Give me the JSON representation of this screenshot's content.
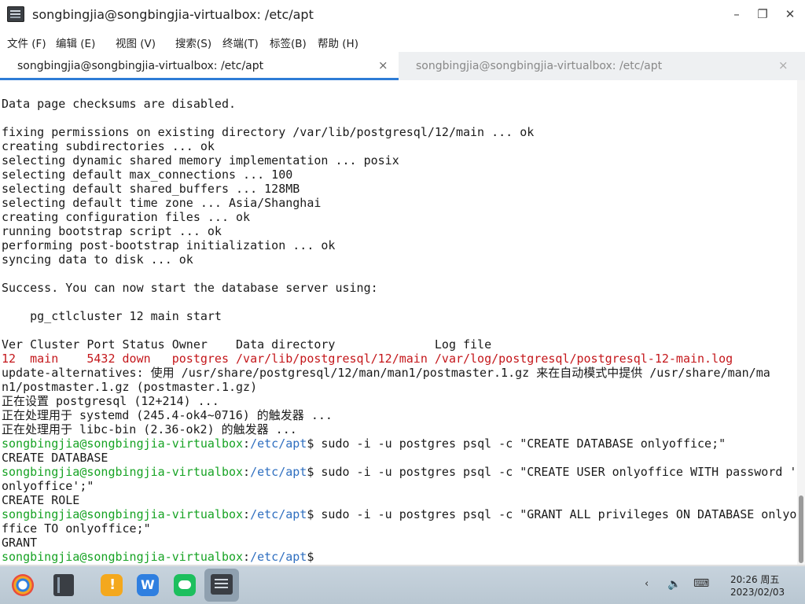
{
  "window": {
    "title": "songbingjia@songbingjia-virtualbox: /etc/apt",
    "minimize_icon": "minimize-icon",
    "maximize_icon": "restore-icon",
    "close_icon": "close-icon",
    "minimize_glyph": "–",
    "maximize_glyph": "❐",
    "close_glyph": "✕"
  },
  "menu": [
    {
      "label": "文件 (F)"
    },
    {
      "label": "编辑 (E)"
    },
    {
      "label": "视图 (V)"
    },
    {
      "label": "搜索(S)"
    },
    {
      "label": "终端(T)"
    },
    {
      "label": "标签(B)"
    },
    {
      "label": "帮助 (H)"
    }
  ],
  "tabs": [
    {
      "label": "songbingjia@songbingjia-virtualbox: /etc/apt",
      "active": true,
      "close": "×"
    },
    {
      "label": "songbingjia@songbingjia-virtualbox: /etc/apt",
      "active": false,
      "close": "×"
    }
  ],
  "terminal": {
    "lines": [
      [
        {
          "t": "Data page checksums are disabled."
        }
      ],
      [
        {
          "t": ""
        }
      ],
      [
        {
          "t": "fixing permissions on existing directory /var/lib/postgresql/12/main ... ok"
        }
      ],
      [
        {
          "t": "creating subdirectories ... ok"
        }
      ],
      [
        {
          "t": "selecting dynamic shared memory implementation ... posix"
        }
      ],
      [
        {
          "t": "selecting default max_connections ... 100"
        }
      ],
      [
        {
          "t": "selecting default shared_buffers ... 128MB"
        }
      ],
      [
        {
          "t": "selecting default time zone ... Asia/Shanghai"
        }
      ],
      [
        {
          "t": "creating configuration files ... ok"
        }
      ],
      [
        {
          "t": "running bootstrap script ... ok"
        }
      ],
      [
        {
          "t": "performing post-bootstrap initialization ... ok"
        }
      ],
      [
        {
          "t": "syncing data to disk ... ok"
        }
      ],
      [
        {
          "t": ""
        }
      ],
      [
        {
          "t": "Success. You can now start the database server using:"
        }
      ],
      [
        {
          "t": ""
        }
      ],
      [
        {
          "t": "    pg_ctlcluster 12 main start"
        }
      ],
      [
        {
          "t": ""
        }
      ],
      [
        {
          "t": "Ver Cluster Port Status Owner    Data directory              Log file"
        }
      ],
      [
        {
          "t": "12  main    5432 down   postgres /var/lib/postgresql/12/main /var/log/postgresql/postgresql-12-main.log",
          "c": "red"
        }
      ],
      [
        {
          "t": "update-alternatives: 使用 /usr/share/postgresql/12/man/man1/postmaster.1.gz 来在自动模式中提供 /usr/share/man/ma"
        }
      ],
      [
        {
          "t": "n1/postmaster.1.gz (postmaster.1.gz)"
        }
      ],
      [
        {
          "t": "正在设置 postgresql (12+214) ..."
        }
      ],
      [
        {
          "t": "正在处理用于 systemd (245.4-ok4~0716) 的触发器 ..."
        }
      ],
      [
        {
          "t": "正在处理用于 libc-bin (2.36-ok2) 的触发器 ..."
        }
      ],
      [
        {
          "t": "songbingjia@songbingjia-virtualbox",
          "c": "user"
        },
        {
          "t": ":"
        },
        {
          "t": "/etc/apt",
          "c": "path"
        },
        {
          "t": "$ sudo -i -u postgres psql -c \"CREATE DATABASE onlyoffice;\""
        }
      ],
      [
        {
          "t": "CREATE DATABASE"
        }
      ],
      [
        {
          "t": "songbingjia@songbingjia-virtualbox",
          "c": "user"
        },
        {
          "t": ":"
        },
        {
          "t": "/etc/apt",
          "c": "path"
        },
        {
          "t": "$ sudo -i -u postgres psql -c \"CREATE USER onlyoffice WITH password '"
        }
      ],
      [
        {
          "t": "onlyoffice';\""
        }
      ],
      [
        {
          "t": "CREATE ROLE"
        }
      ],
      [
        {
          "t": "songbingjia@songbingjia-virtualbox",
          "c": "user"
        },
        {
          "t": ":"
        },
        {
          "t": "/etc/apt",
          "c": "path"
        },
        {
          "t": "$ sudo -i -u postgres psql -c \"GRANT ALL privileges ON DATABASE onlyo"
        }
      ],
      [
        {
          "t": "ffice TO onlyoffice;\""
        }
      ],
      [
        {
          "t": "GRANT"
        }
      ],
      [
        {
          "t": "songbingjia@songbingjia-virtualbox",
          "c": "user"
        },
        {
          "t": ":"
        },
        {
          "t": "/etc/apt",
          "c": "path"
        },
        {
          "t": "$ "
        }
      ]
    ]
  },
  "taskbar": {
    "icons": [
      "start-menu-icon",
      "file-manager-icon",
      "notes-icon",
      "wps-office-icon",
      "wechat-icon",
      "terminal-icon"
    ],
    "tray": {
      "chevron": "‹",
      "volume": "🔈",
      "keyboard": "⌨"
    },
    "clock_time": "20:26 周五",
    "clock_date": "2023/02/03"
  },
  "colors": {
    "prompt_user": "#17a324",
    "prompt_path": "#2f6fc0",
    "error_red": "#c4171b",
    "tab_active_underline": "#2e7cd6"
  }
}
